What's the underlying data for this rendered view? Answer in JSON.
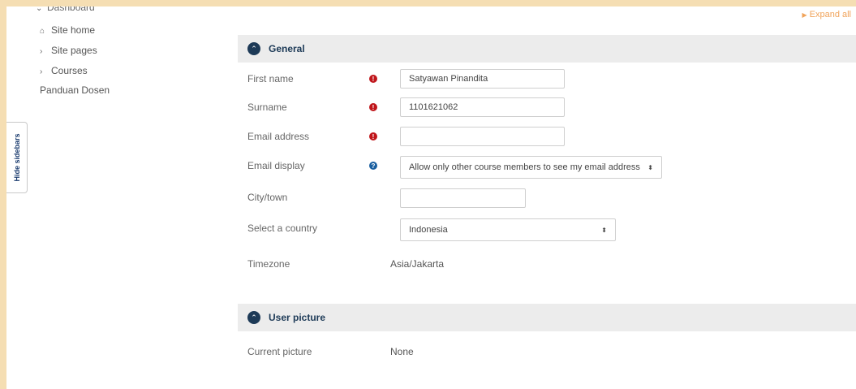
{
  "nav": {
    "dashboard": "Dashboard",
    "site_home": "Site home",
    "site_pages": "Site pages",
    "courses": "Courses",
    "panduan": "Panduan Dosen"
  },
  "hide_sidebars_label": "Hide sidebars",
  "expand_all": "Expand all",
  "sections": {
    "general": "General",
    "user_picture": "User picture"
  },
  "form": {
    "first_name": {
      "label": "First name",
      "value": "Satyawan Pinandita"
    },
    "surname": {
      "label": "Surname",
      "value": "1101621062"
    },
    "email": {
      "label": "Email address",
      "value": ""
    },
    "email_display": {
      "label": "Email display",
      "value": "Allow only other course members to see my email address"
    },
    "city": {
      "label": "City/town",
      "value": ""
    },
    "country": {
      "label": "Select a country",
      "value": "Indonesia"
    },
    "timezone": {
      "label": "Timezone",
      "value": "Asia/Jakarta"
    },
    "current_picture": {
      "label": "Current picture",
      "value": "None"
    }
  },
  "icons": {
    "required": "exclamation-circle-icon",
    "help": "question-circle-icon",
    "section_toggle": "chevron-circle-icon",
    "home": "home-icon"
  },
  "colors": {
    "section_circle": "#1d3a57",
    "required": "#c0161b",
    "help": "#1a5fa0",
    "expand_link": "#f0a35a"
  }
}
